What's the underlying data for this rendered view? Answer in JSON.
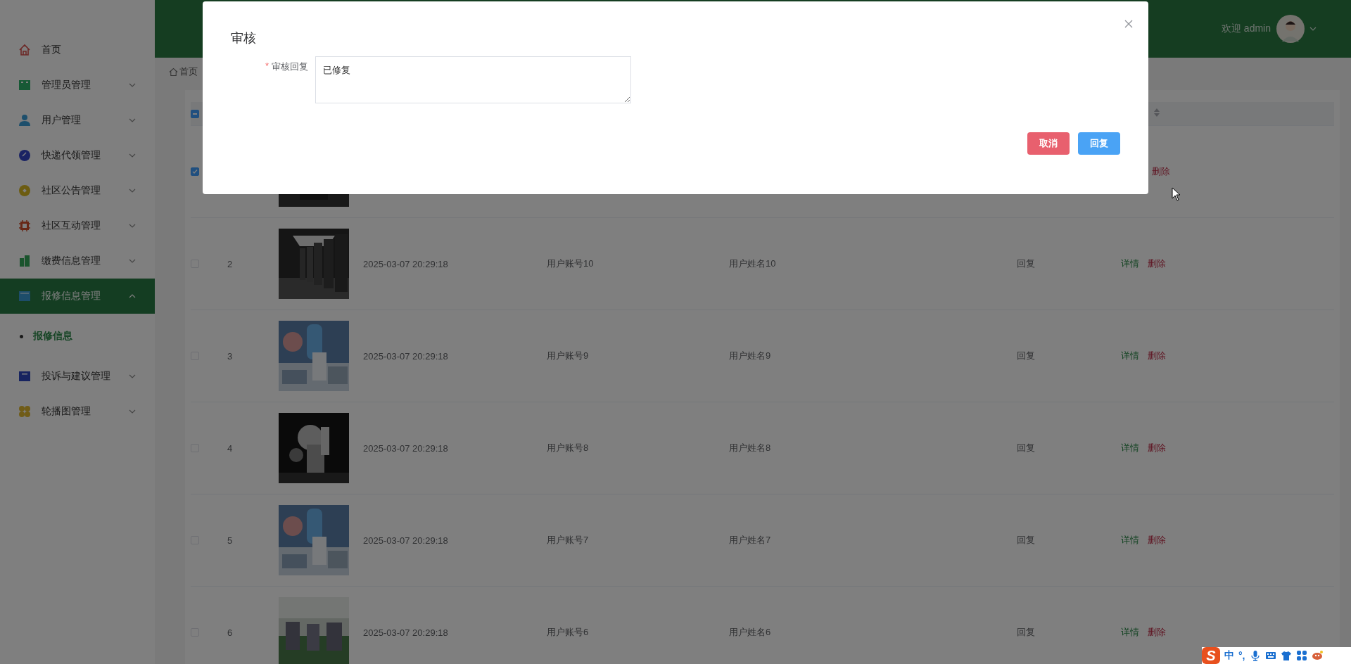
{
  "header": {
    "welcome": "欢迎 admin"
  },
  "sidebar": {
    "items": [
      {
        "label": "首页",
        "kind": "link",
        "selected": false
      },
      {
        "label": "管理员管理",
        "kind": "submenu",
        "expanded": false,
        "selected": false
      },
      {
        "label": "用户管理",
        "kind": "submenu",
        "expanded": false,
        "selected": false
      },
      {
        "label": "快递代领管理",
        "kind": "submenu",
        "expanded": false,
        "selected": false
      },
      {
        "label": "社区公告管理",
        "kind": "submenu",
        "expanded": false,
        "selected": false
      },
      {
        "label": "社区互动管理",
        "kind": "submenu",
        "expanded": false,
        "selected": false
      },
      {
        "label": "缴费信息管理",
        "kind": "submenu",
        "expanded": false,
        "selected": false
      },
      {
        "label": "报修信息管理",
        "kind": "submenu",
        "expanded": true,
        "selected": true,
        "children": [
          {
            "label": "报修信息",
            "selected": true
          }
        ]
      },
      {
        "label": "投诉与建议管理",
        "kind": "submenu",
        "expanded": false,
        "selected": false
      },
      {
        "label": "轮播图管理",
        "kind": "submenu",
        "expanded": false,
        "selected": false
      }
    ]
  },
  "breadcrumb": [
    "首页"
  ],
  "table": {
    "indeterminate": true,
    "rows": [
      {
        "selected": true,
        "image": {
          "kind": "picture"
        },
        "actions": [
          {
            "label": "删除",
            "kind": "delete"
          }
        ]
      },
      {
        "selected": false,
        "index": "2",
        "image": {
          "kind": "picture"
        },
        "date": "2025-03-07 20:29:18",
        "account": "用户账号10",
        "name": "用户姓名10",
        "reply": "回复",
        "actions": [
          {
            "label": "详情",
            "kind": "detail"
          },
          {
            "label": "删除",
            "kind": "delete"
          }
        ]
      },
      {
        "selected": false,
        "index": "3",
        "image": {
          "kind": "picture"
        },
        "date": "2025-03-07 20:29:18",
        "account": "用户账号9",
        "name": "用户姓名9",
        "reply": "回复",
        "actions": [
          {
            "label": "详情",
            "kind": "detail"
          },
          {
            "label": "删除",
            "kind": "delete"
          }
        ]
      },
      {
        "selected": false,
        "index": "4",
        "image": {
          "kind": "picture"
        },
        "date": "2025-03-07 20:29:18",
        "account": "用户账号8",
        "name": "用户姓名8",
        "reply": "回复",
        "actions": [
          {
            "label": "详情",
            "kind": "detail"
          },
          {
            "label": "删除",
            "kind": "delete"
          }
        ]
      },
      {
        "selected": false,
        "index": "5",
        "image": {
          "kind": "picture"
        },
        "date": "2025-03-07 20:29:18",
        "account": "用户账号7",
        "name": "用户姓名7",
        "reply": "回复",
        "actions": [
          {
            "label": "详情",
            "kind": "detail"
          },
          {
            "label": "删除",
            "kind": "delete"
          }
        ]
      },
      {
        "selected": false,
        "index": "6",
        "image": {
          "kind": "picture"
        },
        "date": "2025-03-07 20:29:18",
        "account": "用户账号6",
        "name": "用户姓名6",
        "reply": "回复",
        "actions": [
          {
            "label": "详情",
            "kind": "detail"
          },
          {
            "label": "删除",
            "kind": "delete"
          }
        ]
      }
    ]
  },
  "dialog": {
    "title": "审核",
    "field": {
      "required_mark": "*",
      "label": "审核回复",
      "value": "已修复"
    },
    "buttons": [
      {
        "label": "取消",
        "kind": "cancel"
      },
      {
        "label": "回复",
        "kind": "primary"
      }
    ]
  },
  "ime": {
    "logo": "S",
    "mode": "中",
    "punctuation": "°,"
  }
}
